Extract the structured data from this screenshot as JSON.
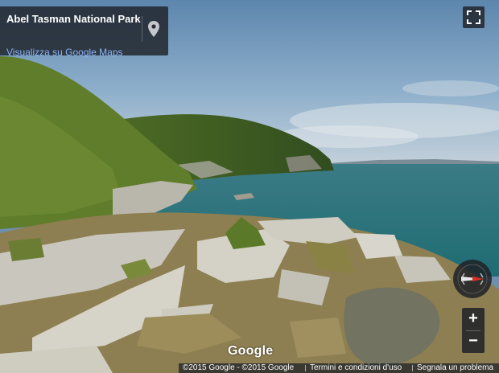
{
  "place": {
    "title": "Abel Tasman National Park",
    "maps_link": "Visualizza su Google Maps",
    "pin_icon": "location-pin-icon"
  },
  "controls": {
    "fullscreen_icon": "fullscreen-icon",
    "compass_icon": "compass-icon",
    "zoom_in_label": "+",
    "zoom_out_label": "−"
  },
  "branding": {
    "logo_text": "Google"
  },
  "footer": {
    "copyright": "©2015 Google - ©2015 Google",
    "terms": "Termini e condizioni d'uso",
    "report": "Segnala un problema"
  },
  "colors": {
    "panel_bg": "#1e2228",
    "link": "#8ab4f8",
    "compass_red": "#d93025"
  }
}
